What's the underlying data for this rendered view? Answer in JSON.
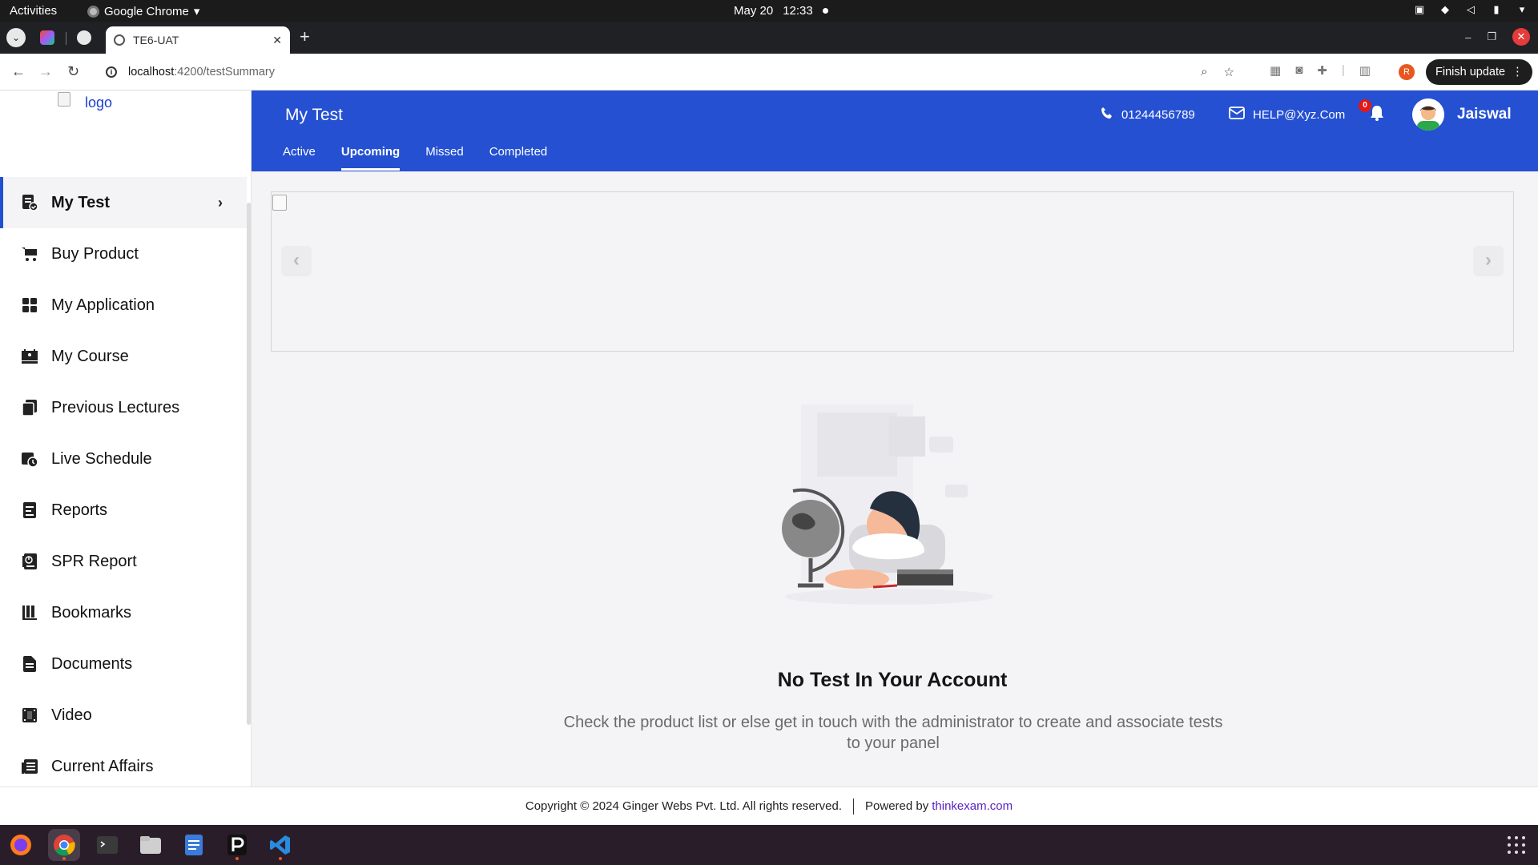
{
  "os_bar": {
    "activities": "Activities",
    "app_name": "Google Chrome",
    "date": "May 20",
    "time": "12:33"
  },
  "browser": {
    "tab_title": "TE6-UAT",
    "url_host": "localhost",
    "url_path": ":4200/testSummary",
    "finish_update": "Finish update",
    "profile_initial": "R"
  },
  "sidebar": {
    "logo_alt": "logo",
    "items": [
      {
        "label": "My Test",
        "icon": "test-list-icon",
        "active": true
      },
      {
        "label": "Buy Product",
        "icon": "cart-icon"
      },
      {
        "label": "My Application",
        "icon": "grid-icon"
      },
      {
        "label": "My Course",
        "icon": "presentation-icon"
      },
      {
        "label": "Previous Lectures",
        "icon": "copy-docs-icon"
      },
      {
        "label": "Live Schedule",
        "icon": "calendar-clock-icon"
      },
      {
        "label": "Reports",
        "icon": "report-icon"
      },
      {
        "label": "SPR Report",
        "icon": "chart-report-icon"
      },
      {
        "label": "Bookmarks",
        "icon": "bookmarks-icon"
      },
      {
        "label": "Documents",
        "icon": "document-icon"
      },
      {
        "label": "Video",
        "icon": "video-icon"
      },
      {
        "label": "Current Affairs",
        "icon": "news-icon"
      }
    ]
  },
  "header": {
    "title": "My Test",
    "phone": "01244456789",
    "email": "HELP@Xyz.Com",
    "notification_count": "0",
    "user_name": "Jaiswal",
    "tabs": [
      {
        "label": "Active"
      },
      {
        "label": "Upcoming",
        "selected": true
      },
      {
        "label": "Missed"
      },
      {
        "label": "Completed"
      }
    ]
  },
  "empty_state": {
    "title": "No Test In Your Account",
    "description": "Check the product list or else get in touch with the administrator to create and associate tests to your panel"
  },
  "footer": {
    "copyright": "Copyright © 2024 Ginger Webs Pvt. Ltd. All rights reserved.",
    "powered_by": "Powered by",
    "link_text": "thinkexam.com"
  },
  "colors": {
    "brand_blue": "#2550d2",
    "badge_red": "#e51616",
    "footer_link": "#5a22c4"
  }
}
